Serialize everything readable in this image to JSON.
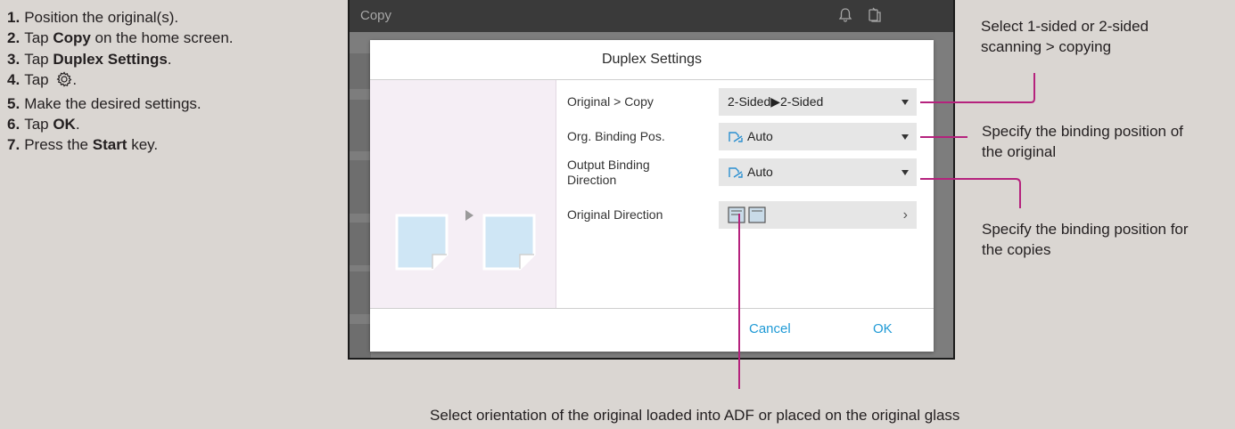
{
  "steps": [
    {
      "num": "1.",
      "pre": "Position the original(s).",
      "bold": "",
      "post": ""
    },
    {
      "num": "2.",
      "pre": "Tap ",
      "bold": "Copy",
      "post": " on the home screen."
    },
    {
      "num": "3.",
      "pre": "Tap ",
      "bold": "Duplex Settings",
      "post": "."
    },
    {
      "num": "4.",
      "pre": "Tap ",
      "bold": "",
      "post": "."
    },
    {
      "num": "5.",
      "pre": "Make the desired settings.",
      "bold": "",
      "post": ""
    },
    {
      "num": "6.",
      "pre": "Tap ",
      "bold": "OK",
      "post": "."
    },
    {
      "num": "7.",
      "pre": "Press the ",
      "bold": "Start",
      "post": " key."
    }
  ],
  "device": {
    "app_title": "Copy",
    "dialog": {
      "title": "Duplex Settings",
      "rows": [
        {
          "label": "Original > Copy",
          "value": "2-Sided▶2-Sided",
          "control": "dropdown"
        },
        {
          "label": "Org. Binding Pos.",
          "value": "Auto",
          "control": "dropdown"
        },
        {
          "label": "Output Binding\nDirection",
          "value": "Auto",
          "control": "dropdown"
        },
        {
          "label": "Original Direction",
          "value": "",
          "control": "chevron"
        }
      ],
      "cancel_label": "Cancel",
      "ok_label": "OK"
    }
  },
  "callouts": {
    "original_copy": "Select 1-sided or 2-sided\nscanning > copying",
    "org_binding": "Specify the binding position of\nthe original",
    "output_binding": "Specify the binding position for\nthe copies",
    "original_direction": "Select orientation of the original loaded into ADF or placed on the original glass"
  },
  "colors": {
    "accent": "#1f9ad6",
    "callout_line": "#b5227d",
    "background": "#dad6d2"
  }
}
